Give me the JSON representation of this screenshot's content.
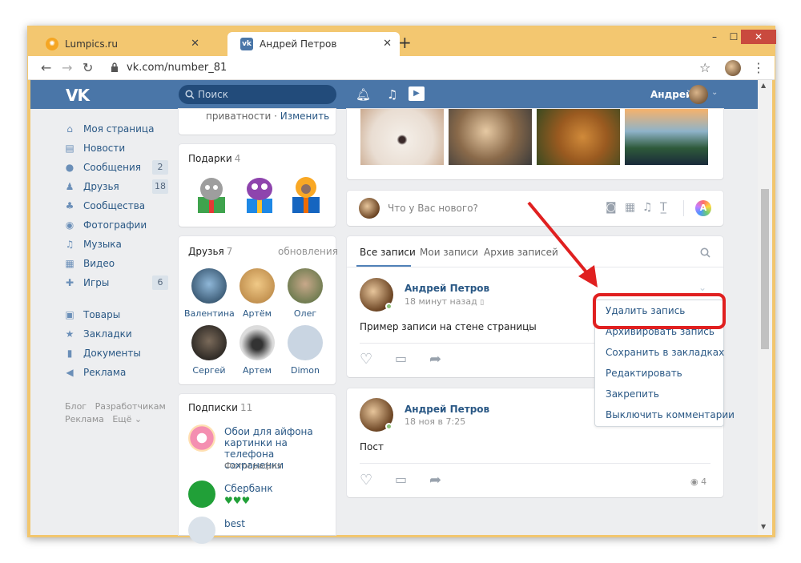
{
  "browser": {
    "tabs": [
      {
        "label": "Lumpics.ru",
        "active": false
      },
      {
        "label": "Андрей Петров",
        "active": true
      }
    ],
    "url": "vk.com/number_81"
  },
  "header": {
    "logo": "VK",
    "search_placeholder": "Поиск",
    "user_name": "Андрей"
  },
  "sidebar": {
    "items": [
      {
        "label": "Моя страница",
        "icon": "home-icon",
        "glyph": "⌂"
      },
      {
        "label": "Новости",
        "icon": "news-icon",
        "glyph": "▤"
      },
      {
        "label": "Сообщения",
        "icon": "messages-icon",
        "glyph": "●",
        "badge": "2"
      },
      {
        "label": "Друзья",
        "icon": "friends-icon",
        "glyph": "♟",
        "badge": "18"
      },
      {
        "label": "Сообщества",
        "icon": "groups-icon",
        "glyph": "♣"
      },
      {
        "label": "Фотографии",
        "icon": "photos-icon",
        "glyph": "◉"
      },
      {
        "label": "Музыка",
        "icon": "music-icon",
        "glyph": "♫"
      },
      {
        "label": "Видео",
        "icon": "video-icon",
        "glyph": "▦"
      },
      {
        "label": "Игры",
        "icon": "games-icon",
        "glyph": "✚",
        "badge": "6"
      },
      {
        "label": "Товары",
        "icon": "market-icon",
        "glyph": "▣"
      },
      {
        "label": "Закладки",
        "icon": "bookmarks-icon",
        "glyph": "★"
      },
      {
        "label": "Документы",
        "icon": "documents-icon",
        "glyph": "▮"
      },
      {
        "label": "Реклама",
        "icon": "ads-icon",
        "glyph": "◀"
      }
    ],
    "footer": {
      "blog": "Блог",
      "developers": "Разработчикам",
      "ads": "Реклама",
      "more": "Ещё ⌄"
    }
  },
  "privacy": {
    "text": "приватности",
    "sep": "·",
    "change": "Изменить"
  },
  "gifts": {
    "title": "Подарки",
    "count": "4"
  },
  "friends": {
    "title": "Друзья",
    "count": "7",
    "updates": "обновления",
    "list": [
      "Валентина",
      "Артём",
      "Олег",
      "Сергей",
      "Артем",
      "Dimon"
    ]
  },
  "subscriptions": {
    "title": "Подписки",
    "count": "11",
    "items": [
      {
        "name": "Обои для айфона картинки на телефона сохраненки",
        "sub": "Фотография"
      },
      {
        "name": "Сбербанк",
        "sub": "♥♥♥"
      },
      {
        "name": "best",
        "sub": ""
      }
    ]
  },
  "composer": {
    "placeholder": "Что у Вас нового?"
  },
  "wall_tabs": [
    "Все записи",
    "Мои записи",
    "Архив записей"
  ],
  "posts": [
    {
      "author": "Андрей Петров",
      "time": "18 минут назад",
      "text": "Пример записи на стене страницы",
      "views": ""
    },
    {
      "author": "Андрей Петров",
      "time": "18 ноя в 7:25",
      "text": "Пост",
      "views": "4"
    }
  ],
  "menu": {
    "items": [
      "Удалить запись",
      "Архивировать запись",
      "Сохранить в закладках",
      "Редактировать",
      "Закрепить",
      "Выключить комментарии"
    ]
  },
  "colors": {
    "vk_blue": "#4a76a8",
    "link": "#2a5885",
    "highlight": "#e02020",
    "window_frame": "#f2c66e"
  }
}
